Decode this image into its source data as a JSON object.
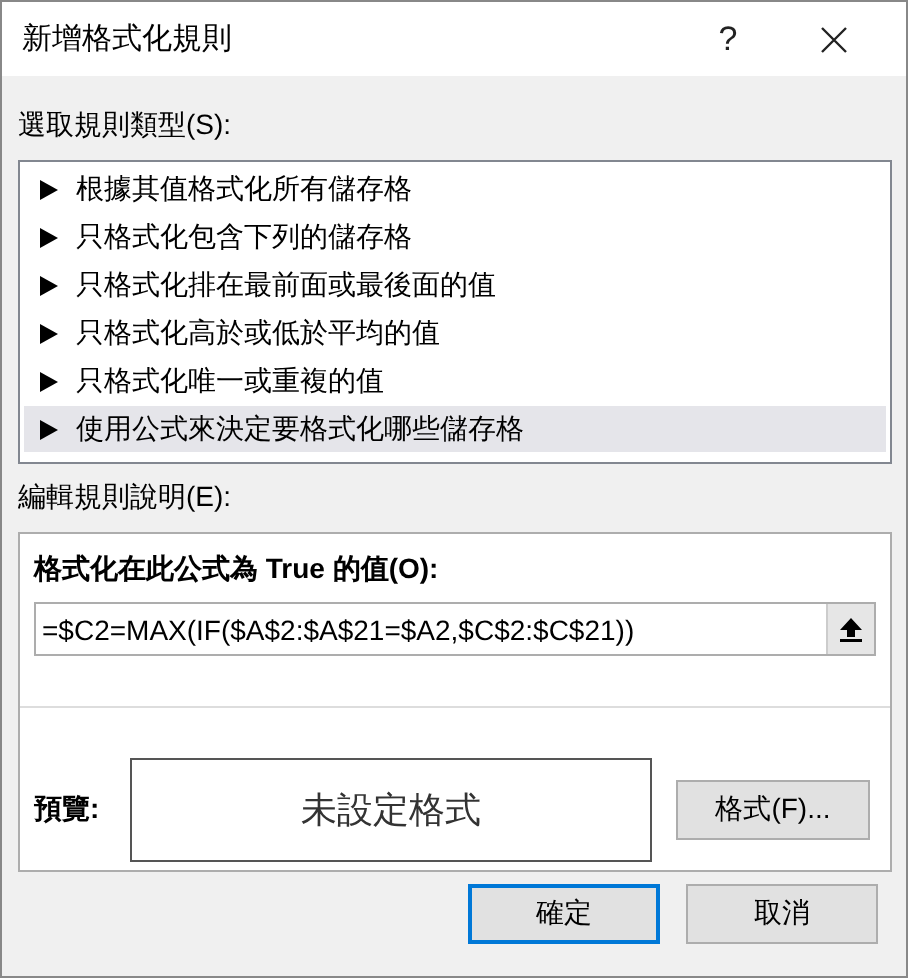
{
  "window": {
    "title": "新增格式化規則",
    "help": "?"
  },
  "rule_type": {
    "label": "選取規則類型(S):",
    "items": [
      {
        "label": "根據其值格式化所有儲存格",
        "selected": false
      },
      {
        "label": "只格式化包含下列的儲存格",
        "selected": false
      },
      {
        "label": "只格式化排在最前面或最後面的值",
        "selected": false
      },
      {
        "label": "只格式化高於或低於平均的值",
        "selected": false
      },
      {
        "label": "只格式化唯一或重複的值",
        "selected": false
      },
      {
        "label": "使用公式來決定要格式化哪些儲存格",
        "selected": true
      }
    ]
  },
  "description": {
    "label": "編輯規則說明(E):",
    "formula_label": "格式化在此公式為 True 的值(O):",
    "formula": "=$C2=MAX(IF($A$2:$A$21=$A2,$C$2:$C$21))",
    "preview_label": "預覽:",
    "preview_text": "未設定格式",
    "format_button": "格式(F)..."
  },
  "buttons": [
    {
      "label": "確定",
      "default": true
    },
    {
      "label": "取消",
      "default": false
    }
  ]
}
